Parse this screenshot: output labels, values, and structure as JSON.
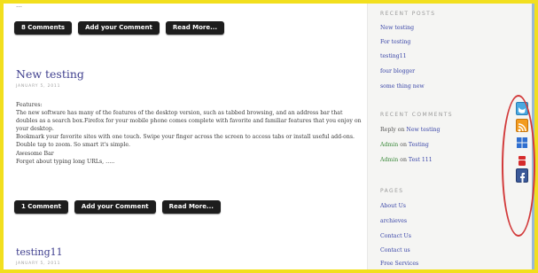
{
  "main": {
    "top_partial_text": "…",
    "first_post_buttons": {
      "comments": "8 Comments",
      "add_comment": "Add your Comment",
      "read_more": "Read More..."
    },
    "second_post": {
      "title": "New testing",
      "date": "JANUARY 5, 2011",
      "body": [
        "Features:",
        "The new software has many of the features of the desktop version, such as tabbed browsing, and an address bar that doubles as a search box.Firefox for your mobile phone comes complete with favorite and familiar features that you enjoy on your desktop.",
        "Bookmark your favorite sites with one touch. Swipe your finger across the screen to access tabs or install useful add-ons. Double tap to zoom. So smart it's simple.",
        "Awesome Bar",
        "Forget about typing long URLs, ….."
      ],
      "buttons": {
        "comments": "1 Comment",
        "add_comment": "Add your Comment",
        "read_more": "Read More..."
      }
    },
    "third_post": {
      "title": "testing11",
      "date": "JANUARY 5, 2011"
    }
  },
  "sidebar": {
    "recent_posts": {
      "heading": "RECENT POSTS",
      "items": [
        "New testing",
        "For testing",
        "testing11",
        "four blogger",
        "some thing new"
      ]
    },
    "recent_comments": {
      "heading": "RECENT COMMENTS",
      "items": [
        {
          "author": "Reply",
          "on": "on",
          "post": "New testing"
        },
        {
          "author": "Admin",
          "on": "on",
          "post": "Testing"
        },
        {
          "author": "Admin",
          "on": "on",
          "post": "Test 111"
        }
      ]
    },
    "pages": {
      "heading": "PAGES",
      "items": [
        "About Us",
        "archieves",
        "Contact Us",
        "Contact us",
        "Free Services"
      ]
    }
  },
  "social_icons": [
    "twitter-icon",
    "rss-icon",
    "windows-icon",
    "youtube-icon",
    "facebook-icon"
  ],
  "colors": {
    "frame": "#f2df1e",
    "title": "#3f3f8e",
    "link": "#3a46a8",
    "button": "#1d1d1d",
    "highlight_ellipse": "#d23a3a"
  }
}
